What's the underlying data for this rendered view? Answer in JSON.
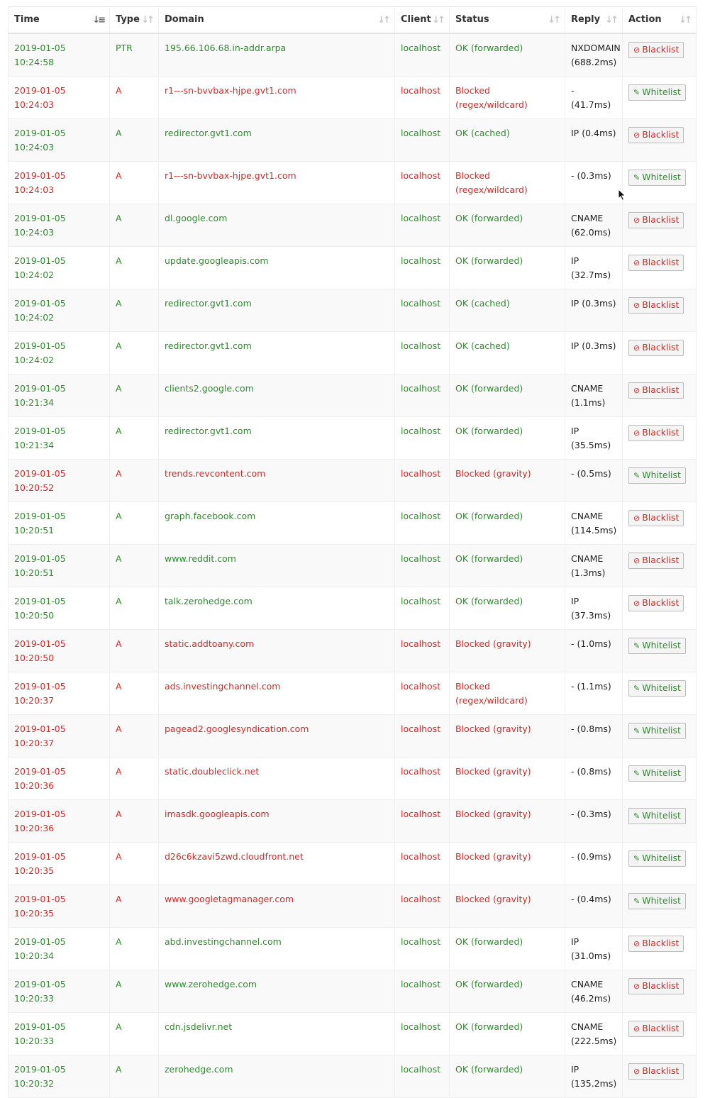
{
  "columns": [
    "Time",
    "Type",
    "Domain",
    "Client",
    "Status",
    "Reply",
    "Action"
  ],
  "sort_column": "Time",
  "action_labels": {
    "blacklist": "Blacklist",
    "whitelist": "Whitelist"
  },
  "colors": {
    "ok": "#2e8b2e",
    "blocked": "#d92626"
  },
  "icons": {
    "blacklist": "ban-icon",
    "whitelist": "edit-icon",
    "sort": "sort-arrows-icon",
    "cursor": "mouse-cursor-icon"
  },
  "rows": [
    {
      "time": "2019-01-05 10:24:58",
      "type": "PTR",
      "domain": "195.66.106.68.in-addr.arpa",
      "client": "localhost",
      "status": "OK (forwarded)",
      "reply": "NXDOMAIN (688.2ms)",
      "blocked": false
    },
    {
      "time": "2019-01-05 10:24:03",
      "type": "A",
      "domain": "r1---sn-bvvbax-hjpe.gvt1.com",
      "client": "localhost",
      "status": "Blocked (regex/wildcard)",
      "reply": "- (41.7ms)",
      "blocked": true
    },
    {
      "time": "2019-01-05 10:24:03",
      "type": "A",
      "domain": "redirector.gvt1.com",
      "client": "localhost",
      "status": "OK (cached)",
      "reply": "IP (0.4ms)",
      "blocked": false
    },
    {
      "time": "2019-01-05 10:24:03",
      "type": "A",
      "domain": "r1---sn-bvvbax-hjpe.gvt1.com",
      "client": "localhost",
      "status": "Blocked (regex/wildcard)",
      "reply": "- (0.3ms)",
      "blocked": true
    },
    {
      "time": "2019-01-05 10:24:03",
      "type": "A",
      "domain": "dl.google.com",
      "client": "localhost",
      "status": "OK (forwarded)",
      "reply": "CNAME (62.0ms)",
      "blocked": false
    },
    {
      "time": "2019-01-05 10:24:02",
      "type": "A",
      "domain": "update.googleapis.com",
      "client": "localhost",
      "status": "OK (forwarded)",
      "reply": "IP (32.7ms)",
      "blocked": false
    },
    {
      "time": "2019-01-05 10:24:02",
      "type": "A",
      "domain": "redirector.gvt1.com",
      "client": "localhost",
      "status": "OK (cached)",
      "reply": "IP (0.3ms)",
      "blocked": false
    },
    {
      "time": "2019-01-05 10:24:02",
      "type": "A",
      "domain": "redirector.gvt1.com",
      "client": "localhost",
      "status": "OK (cached)",
      "reply": "IP (0.3ms)",
      "blocked": false
    },
    {
      "time": "2019-01-05 10:21:34",
      "type": "A",
      "domain": "clients2.google.com",
      "client": "localhost",
      "status": "OK (forwarded)",
      "reply": "CNAME (1.1ms)",
      "blocked": false
    },
    {
      "time": "2019-01-05 10:21:34",
      "type": "A",
      "domain": "redirector.gvt1.com",
      "client": "localhost",
      "status": "OK (forwarded)",
      "reply": "IP (35.5ms)",
      "blocked": false
    },
    {
      "time": "2019-01-05 10:20:52",
      "type": "A",
      "domain": "trends.revcontent.com",
      "client": "localhost",
      "status": "Blocked (gravity)",
      "reply": "- (0.5ms)",
      "blocked": true
    },
    {
      "time": "2019-01-05 10:20:51",
      "type": "A",
      "domain": "graph.facebook.com",
      "client": "localhost",
      "status": "OK (forwarded)",
      "reply": "CNAME (114.5ms)",
      "blocked": false
    },
    {
      "time": "2019-01-05 10:20:51",
      "type": "A",
      "domain": "www.reddit.com",
      "client": "localhost",
      "status": "OK (forwarded)",
      "reply": "CNAME (1.3ms)",
      "blocked": false
    },
    {
      "time": "2019-01-05 10:20:50",
      "type": "A",
      "domain": "talk.zerohedge.com",
      "client": "localhost",
      "status": "OK (forwarded)",
      "reply": "IP (37.3ms)",
      "blocked": false
    },
    {
      "time": "2019-01-05 10:20:50",
      "type": "A",
      "domain": "static.addtoany.com",
      "client": "localhost",
      "status": "Blocked (gravity)",
      "reply": "- (1.0ms)",
      "blocked": true
    },
    {
      "time": "2019-01-05 10:20:37",
      "type": "A",
      "domain": "ads.investingchannel.com",
      "client": "localhost",
      "status": "Blocked (regex/wildcard)",
      "reply": "- (1.1ms)",
      "blocked": true
    },
    {
      "time": "2019-01-05 10:20:37",
      "type": "A",
      "domain": "pagead2.googlesyndication.com",
      "client": "localhost",
      "status": "Blocked (gravity)",
      "reply": "- (0.8ms)",
      "blocked": true
    },
    {
      "time": "2019-01-05 10:20:36",
      "type": "A",
      "domain": "static.doubleclick.net",
      "client": "localhost",
      "status": "Blocked (gravity)",
      "reply": "- (0.8ms)",
      "blocked": true
    },
    {
      "time": "2019-01-05 10:20:36",
      "type": "A",
      "domain": "imasdk.googleapis.com",
      "client": "localhost",
      "status": "Blocked (gravity)",
      "reply": "- (0.3ms)",
      "blocked": true
    },
    {
      "time": "2019-01-05 10:20:35",
      "type": "A",
      "domain": "d26c6kzavi5zwd.cloudfront.net",
      "client": "localhost",
      "status": "Blocked (gravity)",
      "reply": "- (0.9ms)",
      "blocked": true
    },
    {
      "time": "2019-01-05 10:20:35",
      "type": "A",
      "domain": "www.googletagmanager.com",
      "client": "localhost",
      "status": "Blocked (gravity)",
      "reply": "- (0.4ms)",
      "blocked": true
    },
    {
      "time": "2019-01-05 10:20:34",
      "type": "A",
      "domain": "abd.investingchannel.com",
      "client": "localhost",
      "status": "OK (forwarded)",
      "reply": "IP (31.0ms)",
      "blocked": false
    },
    {
      "time": "2019-01-05 10:20:33",
      "type": "A",
      "domain": "www.zerohedge.com",
      "client": "localhost",
      "status": "OK (forwarded)",
      "reply": "CNAME (46.2ms)",
      "blocked": false
    },
    {
      "time": "2019-01-05 10:20:33",
      "type": "A",
      "domain": "cdn.jsdelivr.net",
      "client": "localhost",
      "status": "OK (forwarded)",
      "reply": "CNAME (222.5ms)",
      "blocked": false
    },
    {
      "time": "2019-01-05 10:20:32",
      "type": "A",
      "domain": "zerohedge.com",
      "client": "localhost",
      "status": "OK (forwarded)",
      "reply": "IP (135.2ms)",
      "blocked": false
    }
  ]
}
